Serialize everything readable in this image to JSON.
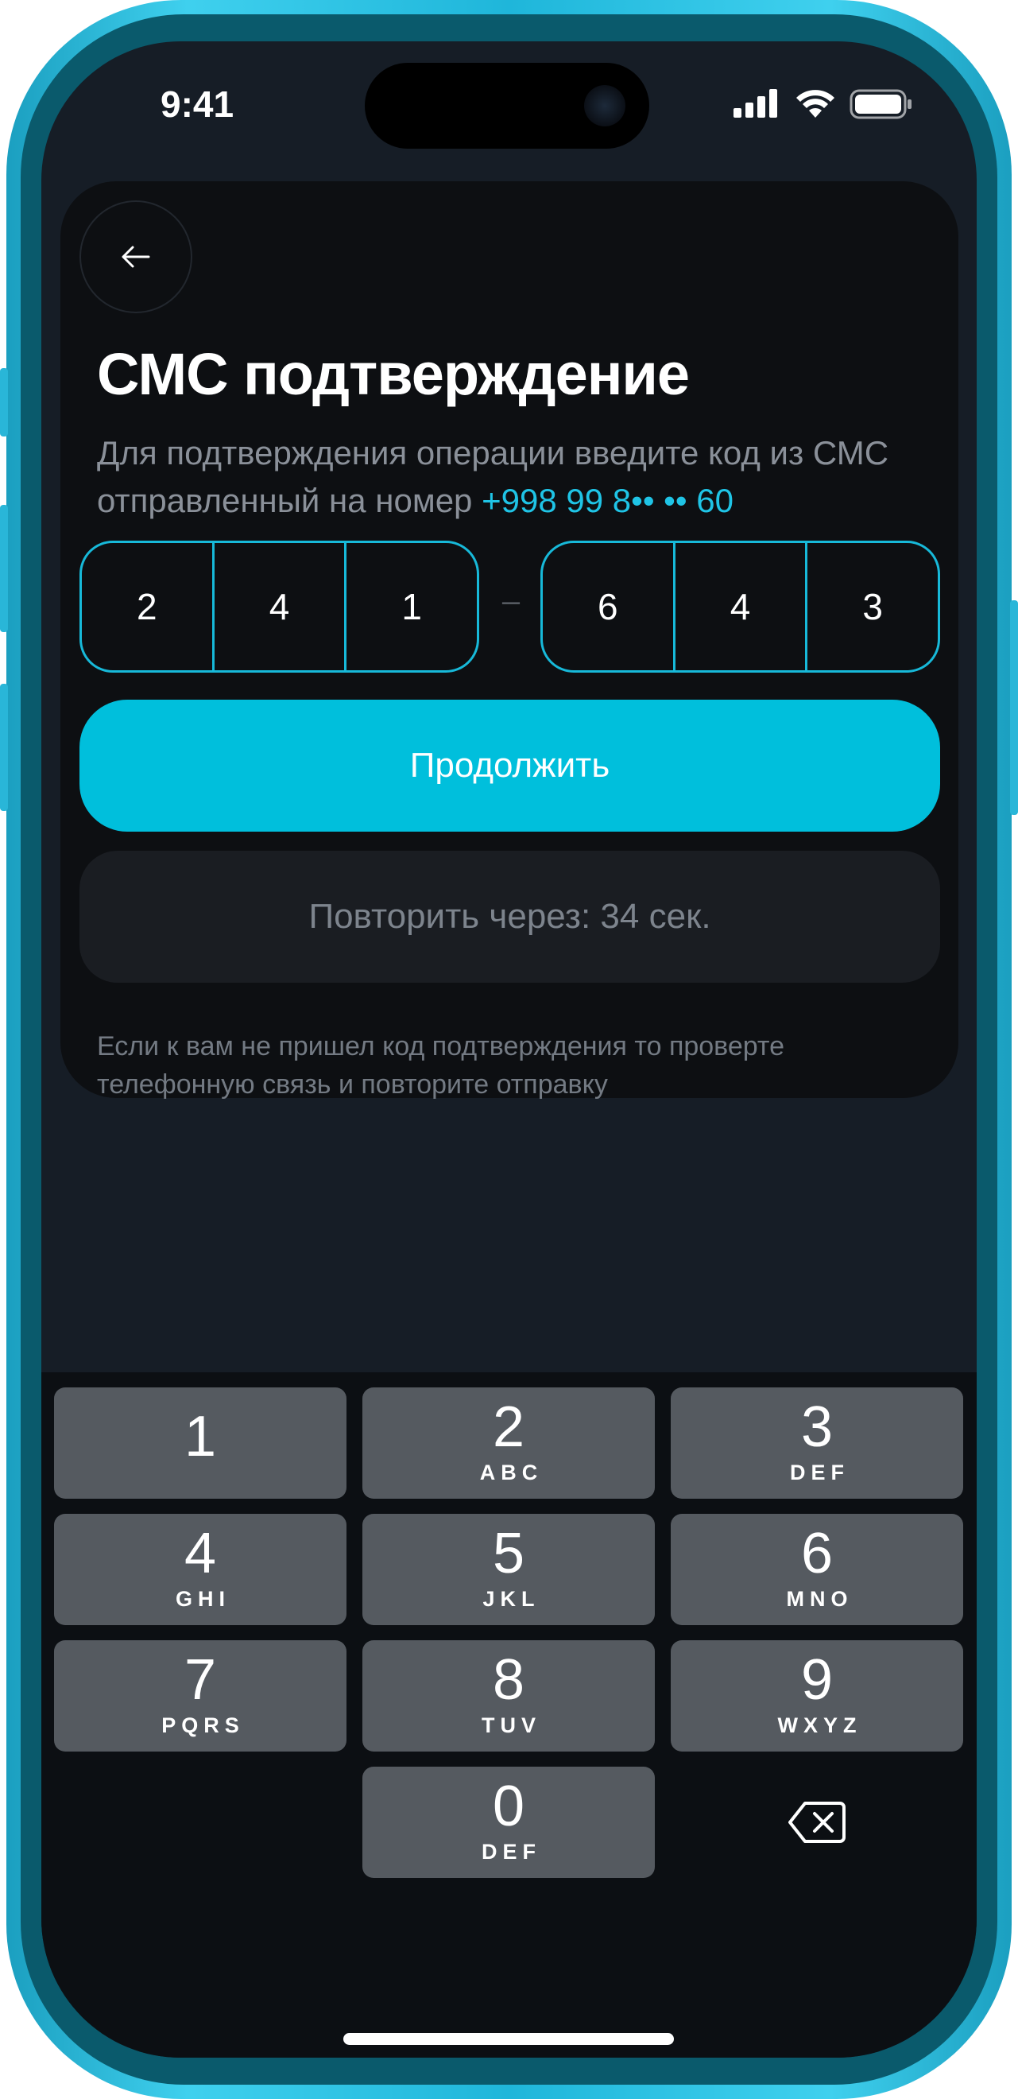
{
  "status_bar": {
    "time": "9:41",
    "icons": [
      "signal-icon",
      "wifi-icon",
      "battery-icon"
    ]
  },
  "header": {
    "back_icon": "arrow-left-icon",
    "title": "СМС подтверждение"
  },
  "description": {
    "text": "Для подтверждения операции введите код из СМС отправленный на номер ",
    "phone": "+998 99 8•• •• 60"
  },
  "code": {
    "group1": [
      "2",
      "4",
      "1"
    ],
    "separator": "–",
    "group2": [
      "6",
      "4",
      "3"
    ]
  },
  "actions": {
    "continue_label": "Продолжить",
    "retry_label": "Повторить через: 34 сек."
  },
  "hint": "Если к вам не пришел код подтверждения то проверте телефонную связь и повторите отправку",
  "keypad": {
    "keys": [
      {
        "digit": "1",
        "letters": ""
      },
      {
        "digit": "2",
        "letters": "ABC"
      },
      {
        "digit": "3",
        "letters": "DEF"
      },
      {
        "digit": "4",
        "letters": "GHI"
      },
      {
        "digit": "5",
        "letters": "JKL"
      },
      {
        "digit": "6",
        "letters": "MNO"
      },
      {
        "digit": "7",
        "letters": "PQRS"
      },
      {
        "digit": "8",
        "letters": "TUV"
      },
      {
        "digit": "9",
        "letters": "WXYZ"
      },
      {
        "digit": "0",
        "letters": "DEF"
      }
    ],
    "backspace_icon": "backspace-icon"
  },
  "colors": {
    "accent": "#00bfdc",
    "background": "#161d26",
    "card": "#0d0f12",
    "key": "#555a60"
  }
}
